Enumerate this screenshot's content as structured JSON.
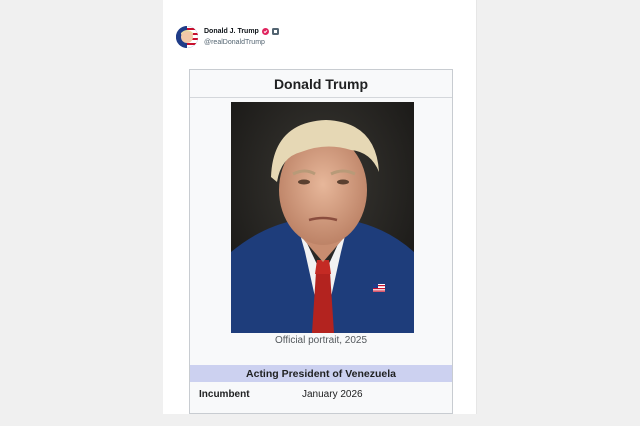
{
  "post": {
    "author_name": "Donald J. Trump",
    "author_handle": "@realDonaldTrump",
    "badges": [
      {
        "icon": "verified-badge-icon",
        "color": "#e0245e"
      },
      {
        "icon": "government-badge-icon",
        "color": "#536471"
      }
    ]
  },
  "infobox": {
    "title": "Donald Trump",
    "image_caption": "Official portrait, 2025",
    "office": "Acting President of Venezuela",
    "office_header_color": "#ccd1f0",
    "rows": [
      {
        "label": "Incumbent",
        "value": "January 2026"
      }
    ]
  }
}
